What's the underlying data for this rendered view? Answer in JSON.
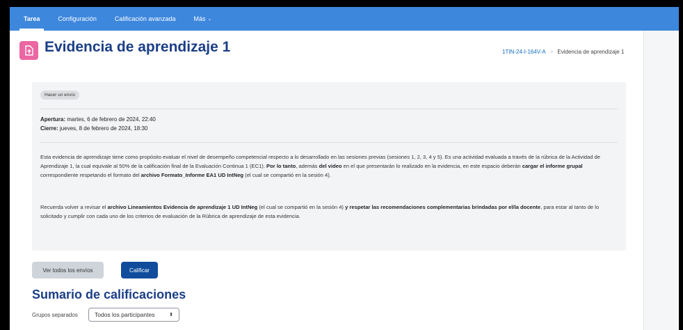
{
  "nav": {
    "tabs": [
      {
        "label": "Tarea",
        "active": true
      },
      {
        "label": "Configuración",
        "active": false
      },
      {
        "label": "Calificación avanzada",
        "active": false
      },
      {
        "label": "Más",
        "active": false
      }
    ],
    "more_caret": "⌄"
  },
  "header": {
    "title": "Evidencia de aprendizaje 1",
    "icon": "assignment-upload-icon",
    "icon_color": "#eb66a2"
  },
  "breadcrumb": {
    "course": "1TIN-24-I-164V-A",
    "separator": ">",
    "current": "Evidencia de aprendizaje 1"
  },
  "activity": {
    "badge": "Hacer un envío",
    "opening_label": "Apertura:",
    "opening_value": " martes, 6 de febrero de 2024, 22:40",
    "closing_label": "Cierre:",
    "closing_value": " jueves, 8 de febrero de 2024, 18:30",
    "p1": {
      "t1": "Esta evidencia de aprendizaje tiene como propósito evaluar el nivel de desempeño competencial respecto a lo desarrollado en las sesiones previas (sesiones 1, 2, 3, 4 y 5). Es una actividad evaluada a través de la rúbrica de la Actividad de Aprendizaje 1, la cual equivale al 50% de la calificación final de la Evaluación Continua 1 (EC1). ",
      "b1": "Por lo tanto",
      "t2": ", además ",
      "b2": "del video",
      "t3": " en el que presentarán lo realizado en la evidencia, en este espacio deberán ",
      "b3": "cargar el informe grupal",
      "t4": " correspondiente respetando el formato del ",
      "b4": "archivo  Formato_Informe EA1 UD IntNeg",
      "t5": " (el cual se compartió en la sesión 4)."
    },
    "p2": {
      "t1": "Recuerda volver a revisar el ",
      "b1": "archivo Lineamientos Evidencia de aprendizaje 1 UD IntNeg",
      "t2": " (el cual se compartió en la sesión 4) ",
      "b2": "y respetar las recomendaciones complementarias brindadas por el/la docente",
      "t3": ", para estar al tanto de lo solicitado  y cumplir con cada uno de los criterios de evaluación de la Rúbrica de aprendizaje de esta evidencia."
    }
  },
  "buttons": {
    "view_all": "Ver todos los envíos",
    "grade": "Calificar"
  },
  "summary": {
    "title": "Sumario de calificaciones",
    "groups_label": "Grupos separados",
    "groups_selected": "Todos los participantes",
    "select_caret": "⬍"
  },
  "colors": {
    "navbar": "#3d87dd",
    "title": "#1b3e86",
    "primary_button": "#0f4c9c"
  }
}
